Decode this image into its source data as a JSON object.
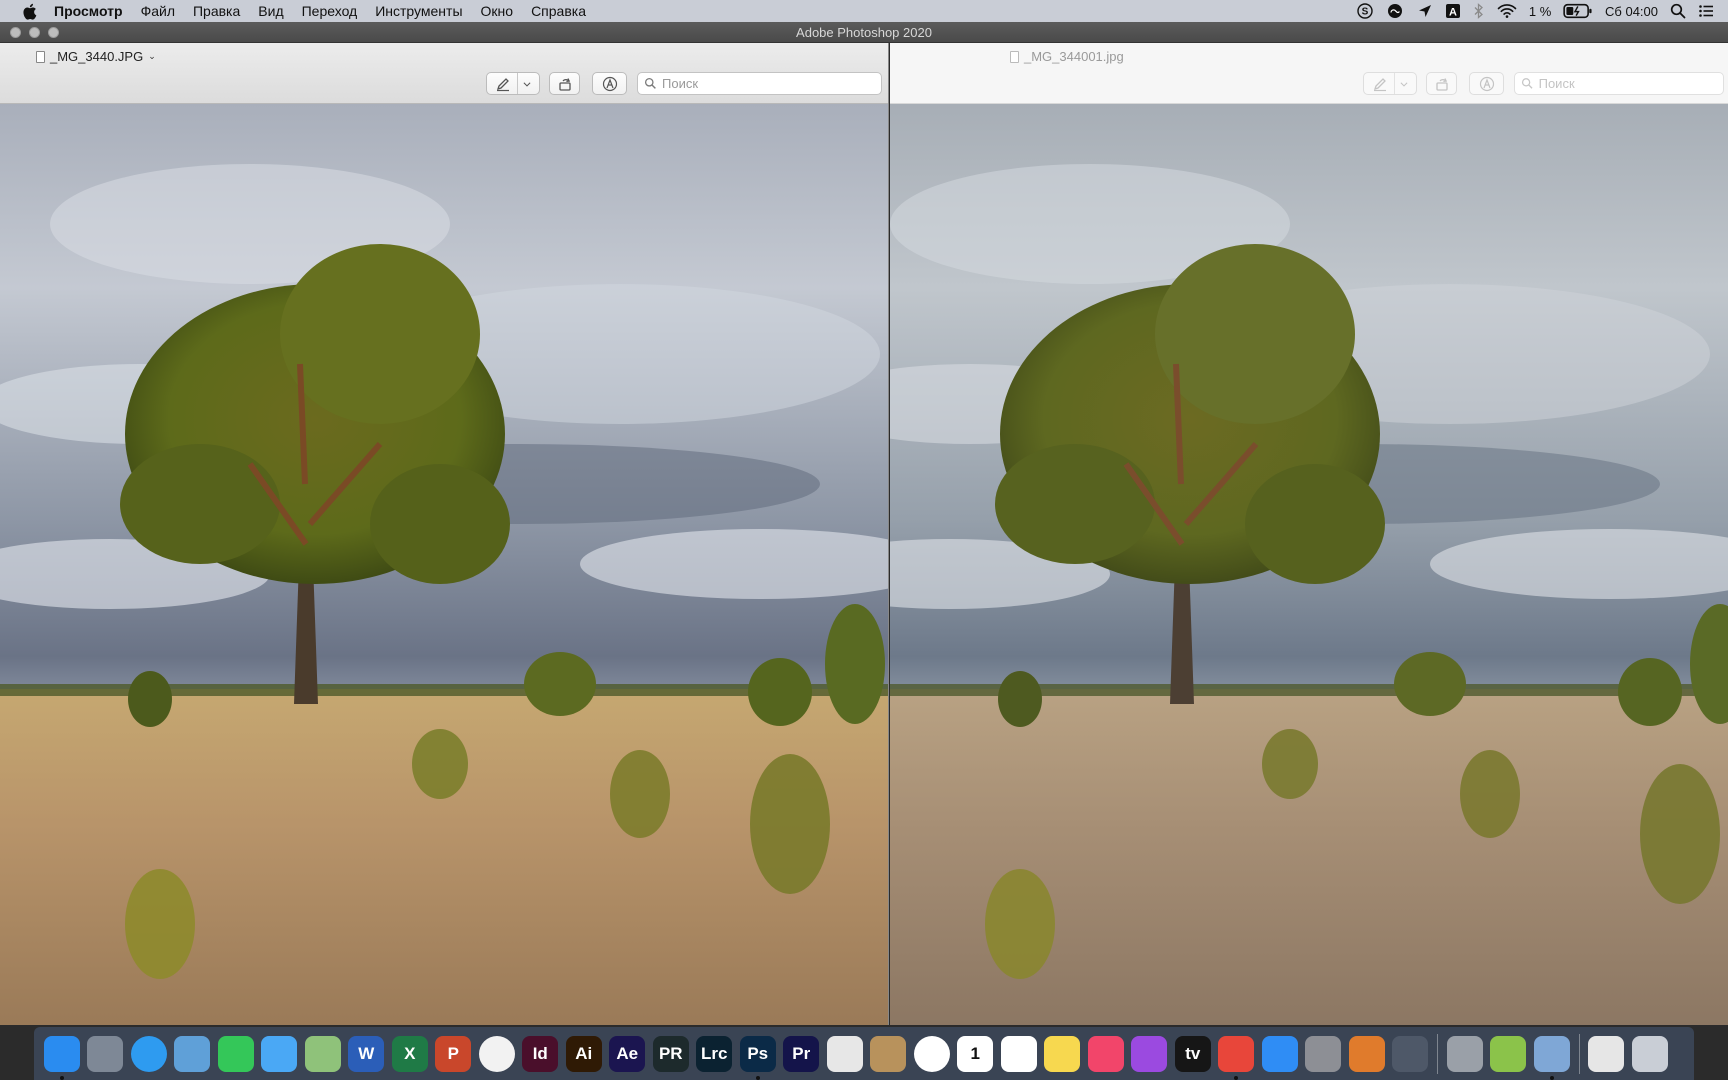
{
  "menubar": {
    "app_name": "Просмотр",
    "items": [
      "Файл",
      "Правка",
      "Вид",
      "Переход",
      "Инструменты",
      "Окно",
      "Справка"
    ],
    "status": {
      "battery_percent": "1 %",
      "clock": "Сб 04:00"
    }
  },
  "window": {
    "title": "Adobe Photoshop 2020"
  },
  "preview_left": {
    "filename": "_MG_3440.JPG",
    "search_placeholder": "Поиск"
  },
  "preview_right": {
    "filename": "_MG_344001.jpg",
    "search_placeholder": "Поиск"
  },
  "dock": {
    "apps": [
      {
        "name": "finder",
        "label": "",
        "bg": "#2a8cf0",
        "running": true
      },
      {
        "name": "launchpad",
        "label": "",
        "bg": "#7e8896",
        "running": false
      },
      {
        "name": "safari",
        "label": "",
        "bg": "#2e9bf0",
        "running": false
      },
      {
        "name": "mail",
        "label": "",
        "bg": "#5fa0d8",
        "running": false
      },
      {
        "name": "facetime",
        "label": "",
        "bg": "#34c759",
        "running": false
      },
      {
        "name": "messages",
        "label": "",
        "bg": "#4aa8f5",
        "running": false
      },
      {
        "name": "maps",
        "label": "",
        "bg": "#8fc27a",
        "running": false
      },
      {
        "name": "word",
        "label": "W",
        "bg": "#2b5eb8",
        "running": false
      },
      {
        "name": "excel",
        "label": "X",
        "bg": "#1f7a46",
        "running": false
      },
      {
        "name": "powerpoint",
        "label": "P",
        "bg": "#c9472b",
        "running": false
      },
      {
        "name": "photos",
        "label": "",
        "bg": "#f2f2f2",
        "running": false
      },
      {
        "name": "indesign",
        "label": "Id",
        "bg": "#4a0f2b",
        "running": false
      },
      {
        "name": "illustrator",
        "label": "Ai",
        "bg": "#2f1a05",
        "running": false
      },
      {
        "name": "after-effects",
        "label": "Ae",
        "bg": "#1b1550",
        "running": false
      },
      {
        "name": "dxo-pureraw",
        "label": "PR",
        "bg": "#1d2a2c",
        "running": false
      },
      {
        "name": "lightroom-classic",
        "label": "Lrc",
        "bg": "#0b2231",
        "running": false
      },
      {
        "name": "photoshop",
        "label": "Ps",
        "bg": "#0b2a47",
        "running": true
      },
      {
        "name": "premiere",
        "label": "Pr",
        "bg": "#14144a",
        "running": false
      },
      {
        "name": "aperture-app",
        "label": "",
        "bg": "#e7e7e7",
        "running": false
      },
      {
        "name": "notebook",
        "label": "",
        "bg": "#b8925c",
        "running": false
      },
      {
        "name": "chrome",
        "label": "",
        "bg": "#ffffff",
        "running": false
      },
      {
        "name": "calendar",
        "label": "1",
        "bg": "#ffffff",
        "running": false
      },
      {
        "name": "reminders",
        "label": "",
        "bg": "#ffffff",
        "running": false
      },
      {
        "name": "notes",
        "label": "",
        "bg": "#f7d84f",
        "running": false
      },
      {
        "name": "music",
        "label": "",
        "bg": "#f2456a",
        "running": false
      },
      {
        "name": "podcasts",
        "label": "",
        "bg": "#9b4ae0",
        "running": false
      },
      {
        "name": "apple-tv",
        "label": "tv",
        "bg": "#161616",
        "running": false
      },
      {
        "name": "anydesk",
        "label": "",
        "bg": "#e8463a",
        "running": true
      },
      {
        "name": "app-store",
        "label": "",
        "bg": "#2f8df5",
        "running": false
      },
      {
        "name": "system-preferences",
        "label": "",
        "bg": "#8d8f95",
        "running": false
      },
      {
        "name": "reeder",
        "label": "",
        "bg": "#e07b2c",
        "running": false
      },
      {
        "name": "image-capture",
        "label": "",
        "bg": "#4e5868",
        "running": false
      }
    ],
    "utilities": [
      {
        "name": "keychain",
        "label": "",
        "bg": "#9aa0a8",
        "running": false
      },
      {
        "name": "android-file-transfer",
        "label": "",
        "bg": "#8bc34a",
        "running": false
      },
      {
        "name": "preview",
        "label": "",
        "bg": "#7fa7d6",
        "running": true
      }
    ],
    "stacks": [
      {
        "name": "documents-stack",
        "label": "",
        "bg": "#e6e6e6",
        "running": false
      },
      {
        "name": "trash",
        "label": "",
        "bg": "#c9ced6",
        "running": false
      }
    ]
  }
}
